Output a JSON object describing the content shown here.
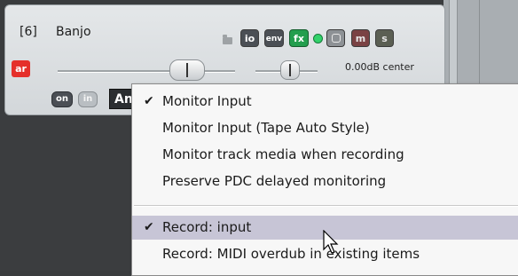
{
  "track": {
    "number": "[6]",
    "name": "Banjo",
    "buttons": {
      "io": "io",
      "env": "env",
      "fx": "fx",
      "mute": "m",
      "solo": "s",
      "automation": "ar",
      "monitor_on": "on",
      "monitor_in": "in"
    },
    "volume_readout": "0.00dB center",
    "input_select_value": "An"
  },
  "menu": {
    "items": [
      {
        "label": "Monitor Input",
        "checked": "✔"
      },
      {
        "label": "Monitor Input (Tape Auto Style)",
        "checked": ""
      },
      {
        "label": "Monitor track media when recording",
        "checked": ""
      },
      {
        "label": "Preserve PDC delayed monitoring",
        "checked": ""
      },
      {
        "label": "Record: input",
        "checked": "✔"
      },
      {
        "label": "Record: MIDI overdub in existing items",
        "checked": ""
      }
    ]
  },
  "colors": {
    "fx_active": "#239e4e",
    "led": "#32d26a",
    "automation": "#e52f2a",
    "menu_highlight": "#c7c5d6"
  }
}
